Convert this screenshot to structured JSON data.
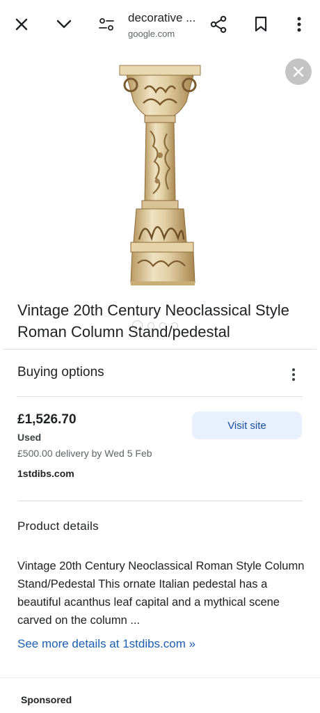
{
  "header": {
    "title": "decorative ...",
    "domain": "google.com",
    "icons": [
      "close-icon",
      "chevron-down-icon",
      "filter-icon",
      "share-icon",
      "bookmark-icon",
      "more-vert-icon"
    ]
  },
  "image": {
    "carousel_count": 4,
    "active_index": 0
  },
  "product": {
    "title": "Vintage 20th Century Neoclassical Style Roman Column Stand/pedestal"
  },
  "buying_options": {
    "label": "Buying options",
    "price": "£1,526.70",
    "condition": "Used",
    "delivery": "£500.00 delivery by Wed 5 Feb",
    "merchant": "1stdibs.com",
    "visit_label": "Visit site"
  },
  "product_details": {
    "heading": "Product details",
    "description": "Vintage 20th Century Neoclassical Roman Style Column Stand/Pedestal This ornate Italian pedestal has a beautiful acanthus leaf capital and a mythical scene carved on the column ...",
    "more_link": "See more details at 1stdibs.com »"
  },
  "footer": {
    "sponsored": "Sponsored"
  },
  "colors": {
    "link": "#1a5fb4",
    "button_bg": "#e8f0fe",
    "divider": "#dadce0"
  }
}
